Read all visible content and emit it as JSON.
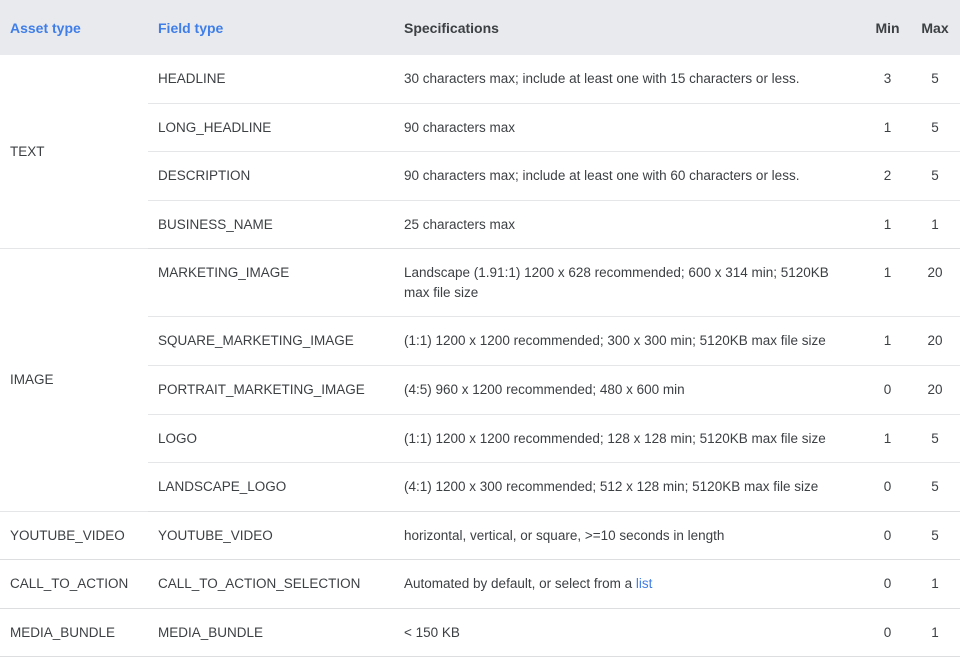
{
  "table": {
    "headers": {
      "asset_type": "Asset type",
      "field_type": "Field type",
      "specifications": "Specifications",
      "min": "Min",
      "max": "Max"
    },
    "colors": {
      "header_background": "#e9eaee",
      "header_link_text": "#3f7ee8",
      "header_plain_text": "#3c4043",
      "body_text": "#3c4043",
      "row_divider": "#e4e6e8",
      "inline_link": "#3f7ee8"
    },
    "groups": [
      {
        "asset_type": "TEXT",
        "rows": [
          {
            "field_type": "HEADLINE",
            "specifications": "30 characters max; include at least one with 15 characters or less.",
            "min": "3",
            "max": "5"
          },
          {
            "field_type": "LONG_HEADLINE",
            "specifications": "90 characters max",
            "min": "1",
            "max": "5"
          },
          {
            "field_type": "DESCRIPTION",
            "specifications": "90 characters max; include at least one with 60 characters or less.",
            "min": "2",
            "max": "5"
          },
          {
            "field_type": "BUSINESS_NAME",
            "specifications": "25 characters max",
            "min": "1",
            "max": "1"
          }
        ]
      },
      {
        "asset_type": "IMAGE",
        "rows": [
          {
            "field_type": "MARKETING_IMAGE",
            "specifications": "Landscape (1.91:1) 1200 x 628 recommended; 600 x 314 min; 5120KB max file size",
            "min": "1",
            "max": "20"
          },
          {
            "field_type": "SQUARE_MARKETING_IMAGE",
            "specifications": "(1:1) 1200 x 1200 recommended; 300 x 300 min; 5120KB max file size",
            "min": "1",
            "max": "20"
          },
          {
            "field_type": "PORTRAIT_MARKETING_IMAGE",
            "specifications": "(4:5) 960 x 1200 recommended; 480 x 600 min",
            "min": "0",
            "max": "20"
          },
          {
            "field_type": "LOGO",
            "specifications": "(1:1) 1200 x 1200 recommended; 128 x 128 min; 5120KB max file size",
            "min": "1",
            "max": "5"
          },
          {
            "field_type": "LANDSCAPE_LOGO",
            "specifications": "(4:1) 1200 x 300 recommended; 512 x 128 min; 5120KB max file size",
            "min": "0",
            "max": "5"
          }
        ]
      },
      {
        "asset_type": "YOUTUBE_VIDEO",
        "rows": [
          {
            "field_type": "YOUTUBE_VIDEO",
            "specifications": "horizontal, vertical, or square, >=10 seconds in length",
            "min": "0",
            "max": "5"
          }
        ]
      },
      {
        "asset_type": "CALL_TO_ACTION",
        "rows": [
          {
            "field_type": "CALL_TO_ACTION_SELECTION",
            "specifications": "Automated by default, or select from a ",
            "link_text": "list",
            "min": "0",
            "max": "1"
          }
        ]
      },
      {
        "asset_type": "MEDIA_BUNDLE",
        "rows": [
          {
            "field_type": "MEDIA_BUNDLE",
            "specifications": "< 150 KB",
            "min": "0",
            "max": "1"
          }
        ]
      }
    ]
  }
}
